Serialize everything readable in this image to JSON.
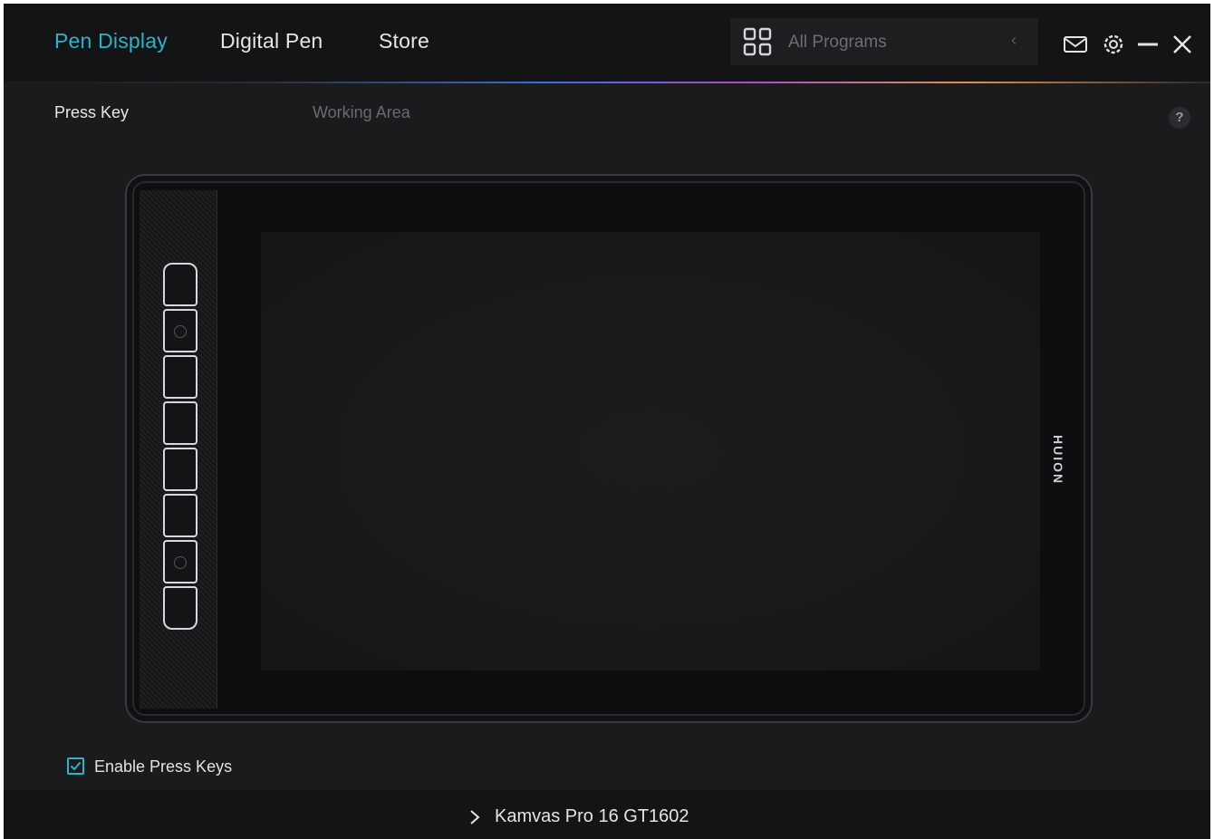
{
  "header": {
    "tabs": [
      {
        "label": "Pen Display",
        "active": true
      },
      {
        "label": "Digital Pen",
        "active": false
      },
      {
        "label": "Store",
        "active": false
      }
    ],
    "programs": {
      "label": "All Programs",
      "icon": "grid-icon"
    },
    "controls": [
      "mail-icon",
      "settings-icon",
      "minimize-icon",
      "close-icon"
    ]
  },
  "subtabs": [
    {
      "label": "Press Key",
      "active": true
    },
    {
      "label": "Working Area",
      "active": false
    }
  ],
  "help": {
    "label": "?"
  },
  "tablet": {
    "brand": "HUION",
    "press_key_count": 8
  },
  "options": {
    "enable_press_keys": {
      "label": "Enable Press Keys",
      "checked": true
    }
  },
  "footer": {
    "device_name": "Kamvas Pro 16 GT1602"
  },
  "colors": {
    "accent": "#2bb3c9",
    "background": "#1b1b1d",
    "header": "#141416"
  }
}
